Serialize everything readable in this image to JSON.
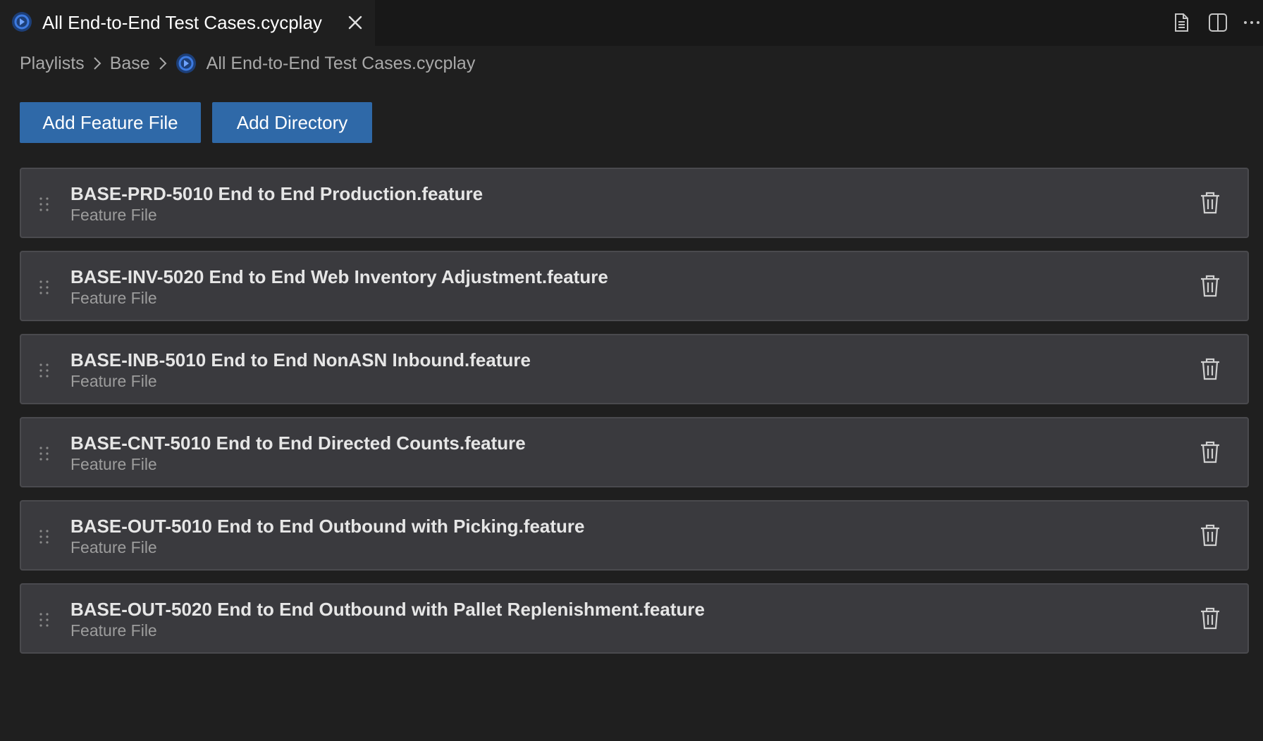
{
  "tab": {
    "icon": "cycplay-logo-icon",
    "title": "All End-to-End Test Cases.cycplay",
    "close_icon": "close-icon"
  },
  "editor_actions": [
    {
      "icon": "open-file-icon"
    },
    {
      "icon": "split-editor-icon"
    },
    {
      "icon": "more-actions-icon"
    }
  ],
  "breadcrumb": {
    "items": [
      "Playlists",
      "Base",
      "All End-to-End Test Cases.cycplay"
    ],
    "separator_icon": "chevron-right-icon"
  },
  "toolbar": {
    "add_feature_file_label": "Add Feature File",
    "add_directory_label": "Add Directory",
    "accent_color": "#2f69a8"
  },
  "playlist_items": [
    {
      "title": "BASE-PRD-5010 End to End Production.feature",
      "type": "Feature File"
    },
    {
      "title": "BASE-INV-5020 End to End Web Inventory Adjustment.feature",
      "type": "Feature File"
    },
    {
      "title": "BASE-INB-5010 End to End NonASN Inbound.feature",
      "type": "Feature File"
    },
    {
      "title": "BASE-CNT-5010 End to End Directed Counts.feature",
      "type": "Feature File"
    },
    {
      "title": "BASE-OUT-5010 End to End Outbound with Picking.feature",
      "type": "Feature File"
    },
    {
      "title": "BASE-OUT-5020 End to End Outbound with Pallet Replenishment.feature",
      "type": "Feature File"
    }
  ]
}
